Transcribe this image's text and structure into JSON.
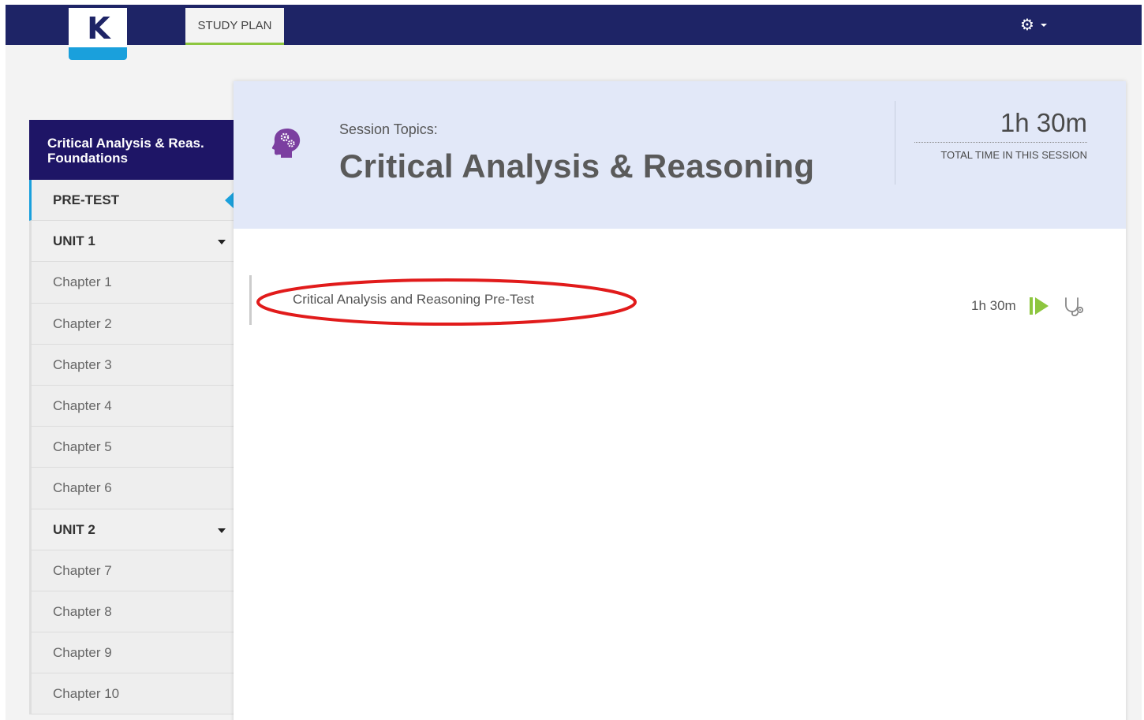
{
  "topbar": {
    "logo_letter": "K",
    "study_plan_tab": "STUDY PLAN",
    "settings_icon": "gear-icon",
    "colors": {
      "nav_bg": "#1e2466",
      "accent_blue": "#1aa0dc",
      "accent_green": "#8dc63f"
    }
  },
  "sidebar": {
    "header_line1": "Critical Analysis & Reas.",
    "header_line2": "Foundations",
    "items": [
      {
        "label": "PRE-TEST",
        "type": "section",
        "active": true
      },
      {
        "label": "UNIT 1",
        "type": "unit",
        "expanded": true
      },
      {
        "label": "Chapter 1",
        "type": "chapter"
      },
      {
        "label": "Chapter 2",
        "type": "chapter"
      },
      {
        "label": "Chapter 3",
        "type": "chapter"
      },
      {
        "label": "Chapter 4",
        "type": "chapter"
      },
      {
        "label": "Chapter 5",
        "type": "chapter"
      },
      {
        "label": "Chapter 6",
        "type": "chapter"
      },
      {
        "label": "UNIT 2",
        "type": "unit",
        "expanded": true
      },
      {
        "label": "Chapter 7",
        "type": "chapter"
      },
      {
        "label": "Chapter 8",
        "type": "chapter"
      },
      {
        "label": "Chapter 9",
        "type": "chapter"
      },
      {
        "label": "Chapter 10",
        "type": "chapter"
      }
    ]
  },
  "session": {
    "icon": "brain-gears-icon",
    "label": "Session Topics:",
    "title": "Critical Analysis & Reasoning",
    "total_time": "1h 30m",
    "total_time_label": "TOTAL TIME IN THIS SESSION"
  },
  "tasks": [
    {
      "name": "Critical Analysis and Reasoning Pre-Test",
      "time": "1h 30m",
      "actions": [
        "play-icon",
        "stethoscope-icon"
      ],
      "highlighted": true
    }
  ]
}
